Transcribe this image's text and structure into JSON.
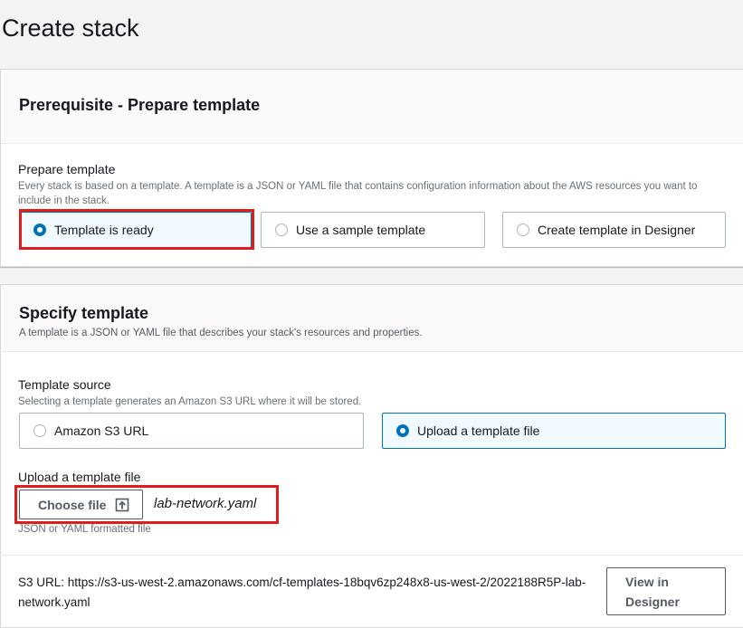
{
  "page": {
    "title": "Create stack"
  },
  "prerequisite": {
    "heading": "Prerequisite - Prepare template",
    "label": "Prepare template",
    "description": "Every stack is based on a template. A template is a JSON or YAML file that contains configuration information about the AWS resources you want to include in the stack.",
    "options": [
      {
        "label": "Template is ready",
        "selected": true
      },
      {
        "label": "Use a sample template",
        "selected": false
      },
      {
        "label": "Create template in Designer",
        "selected": false
      }
    ]
  },
  "specify": {
    "heading": "Specify template",
    "description": "A template is a JSON or YAML file that describes your stack's resources and properties.",
    "source_label": "Template source",
    "source_description": "Selecting a template generates an Amazon S3 URL where it will be stored.",
    "source_options": [
      {
        "label": "Amazon S3 URL",
        "selected": false
      },
      {
        "label": "Upload a template file",
        "selected": true
      }
    ],
    "upload_label": "Upload a template file",
    "choose_file_label": "Choose file",
    "file_name": "lab-network.yaml",
    "file_hint": "JSON or YAML formatted file",
    "s3_url_text": "S3 URL:  https://s3-us-west-2.amazonaws.com/cf-templates-18bqv6zp248x8-us-west-2/2022188R5P-lab-network.yaml",
    "view_designer_label": "View in Designer"
  },
  "colors": {
    "accent": "#0073bb",
    "highlight": "#e01d1d",
    "selected_bg": "#f1faff"
  }
}
